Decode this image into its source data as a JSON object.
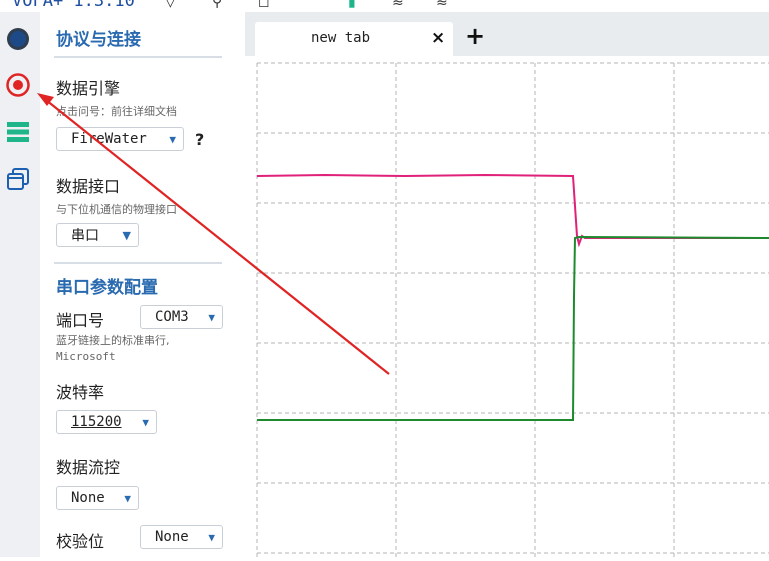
{
  "app": {
    "title": "VOFA+ 1.3.10"
  },
  "panel": {
    "section_protocol": "协议与连接",
    "engine": {
      "label": "数据引擎",
      "hint": "点击问号：前往详细文档",
      "value": "FireWater",
      "help": "?"
    },
    "iface": {
      "label": "数据接口",
      "hint": "与下位机通信的物理接口",
      "value": "串口"
    },
    "section_serial": "串口参数配置",
    "port": {
      "label": "端口号",
      "value": "COM3",
      "hint1": "蓝牙链接上的标准串行,",
      "hint2": "Microsoft"
    },
    "baud": {
      "label": "波特率",
      "value": "115200"
    },
    "flow": {
      "label": "数据流控",
      "value": "None"
    },
    "parity": {
      "label": "校验位",
      "value": "None"
    }
  },
  "tabs": {
    "items": [
      {
        "label": "new tab",
        "close": "×"
      }
    ],
    "add": "+"
  },
  "colors": {
    "accent": "#2a6ab0",
    "series_magenta": "#e0207a",
    "series_green": "#1e8a2e",
    "annotation_red": "#e02424"
  },
  "icons": [
    "connect-icon",
    "record-icon",
    "list-icon",
    "windows-icon",
    "close-icon",
    "add-icon"
  ]
}
